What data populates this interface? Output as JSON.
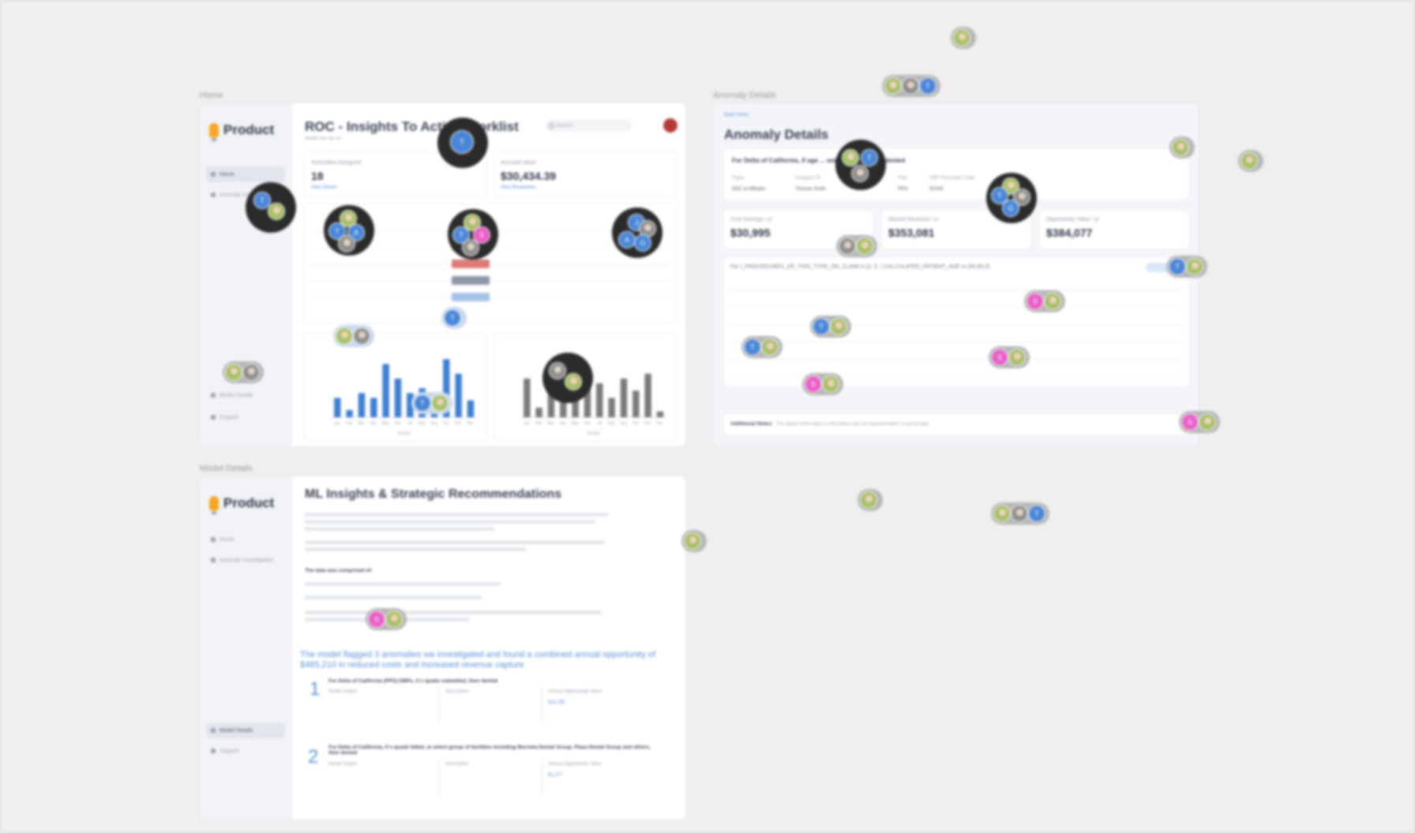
{
  "frames": {
    "home": {
      "label": "Home"
    },
    "anomaly": {
      "label": "Anomaly Details"
    },
    "model": {
      "label": "Model Details"
    }
  },
  "brand": {
    "name": "Product"
  },
  "home": {
    "nav": [
      {
        "label": "Home"
      },
      {
        "label": "Anomaly Investigation"
      }
    ],
    "nav_bottom": [
      {
        "label": "Model Details"
      },
      {
        "label": "Support"
      }
    ],
    "title": "ROC - Insights To Action Worklist",
    "subtitle": "Model last ran on",
    "search_placeholder": "Search",
    "cards": [
      {
        "label": "Anomalies Assigned",
        "value": "18",
        "link": "View Details"
      },
      {
        "label": "Accrued Value",
        "value": "$30,434.39",
        "link": "View Breakdown"
      }
    ]
  },
  "anomaly": {
    "back": "Back Home",
    "title": "Anomaly Details",
    "headline": "For Delta of California, if age ... units billed, will be denied",
    "fields": [
      {
        "label": "Payer",
        "value": "DDC & Affiliates"
      },
      {
        "label": "Assigned To",
        "value": "Thomas Smith"
      },
      {
        "label": "Plan",
        "value": "PPO"
      },
      {
        "label": "DBP Procedure Code",
        "value": "D0150"
      }
    ],
    "cards": [
      {
        "label": "Cost Savings / yr",
        "value": "$30,995"
      },
      {
        "label": "Missed Revenue / yr",
        "value": "$353,081"
      },
      {
        "label": "Opportunity Value / yr",
        "value": "$384,077"
      }
    ],
    "table_title": "For I_PROCEDURES_OF_THIS_TYPE_ON_CLAIM in [2, 5, ) CALCULATED_PATIENT_AGE in (50,90.0)",
    "notes_label": "Additional Notes:",
    "notes_text": "The above information is illustrative and not representative of actual data."
  },
  "model": {
    "nav": [
      {
        "label": "Home"
      },
      {
        "label": "Anomaly Investigation"
      }
    ],
    "nav_bottom": [
      {
        "label": "Model Details"
      },
      {
        "label": "Support"
      }
    ],
    "title": "ML Insights & Strategic Recommendations",
    "highlight": "The model flagged 3 anomalies we investigated and found a combined annual opportunity of $485,210 in reduced costs and increased revenue capture",
    "data_heading": "The data was comprised of:",
    "items": [
      {
        "number": "1",
        "heading": "For Delta of California (PPO) DBPs, if n quads submitted, then denied",
        "value": "$16,795"
      },
      {
        "number": "2",
        "heading": "For Delta of California, if n quads billed, at select group of facilities including Murrieta Dental Group, Plaza Dental Group and others, then denied",
        "value": "$1,277"
      }
    ],
    "col_labels": {
      "output": "Model Output",
      "description": "Description",
      "value": "Annual Opportunity Value"
    }
  },
  "chart_data": [
    {
      "type": "bar",
      "title": "",
      "categories": [
        "Jan",
        "Feb",
        "Mar",
        "Apr",
        "May",
        "Jun",
        "Jul",
        "Aug",
        "Sep",
        "Oct",
        "Nov",
        "Dec"
      ],
      "series": [
        {
          "values": [
            4,
            1.5,
            5,
            4,
            11,
            8,
            5,
            6,
            4.5,
            12,
            9,
            3.5
          ]
        }
      ],
      "xlabel": "Months",
      "ylim": [
        0,
        14
      ]
    },
    {
      "type": "bar",
      "title": "",
      "categories": [
        "Jan",
        "Feb",
        "Mar",
        "Apr",
        "May",
        "Jun",
        "Jul",
        "Aug",
        "Sep",
        "Oct",
        "Nov",
        "Dec"
      ],
      "series": [
        {
          "values": [
            8,
            2,
            7,
            11,
            5,
            9,
            7,
            4,
            8,
            5.5,
            9,
            1.2
          ]
        }
      ],
      "xlabel": "Months",
      "ylim": [
        0,
        14
      ]
    }
  ],
  "colors": {
    "accent": "#5a8fd6",
    "chart1": "#3d7fd3",
    "chart2": "#7a7a7a",
    "pink": "#ea5ec8"
  }
}
